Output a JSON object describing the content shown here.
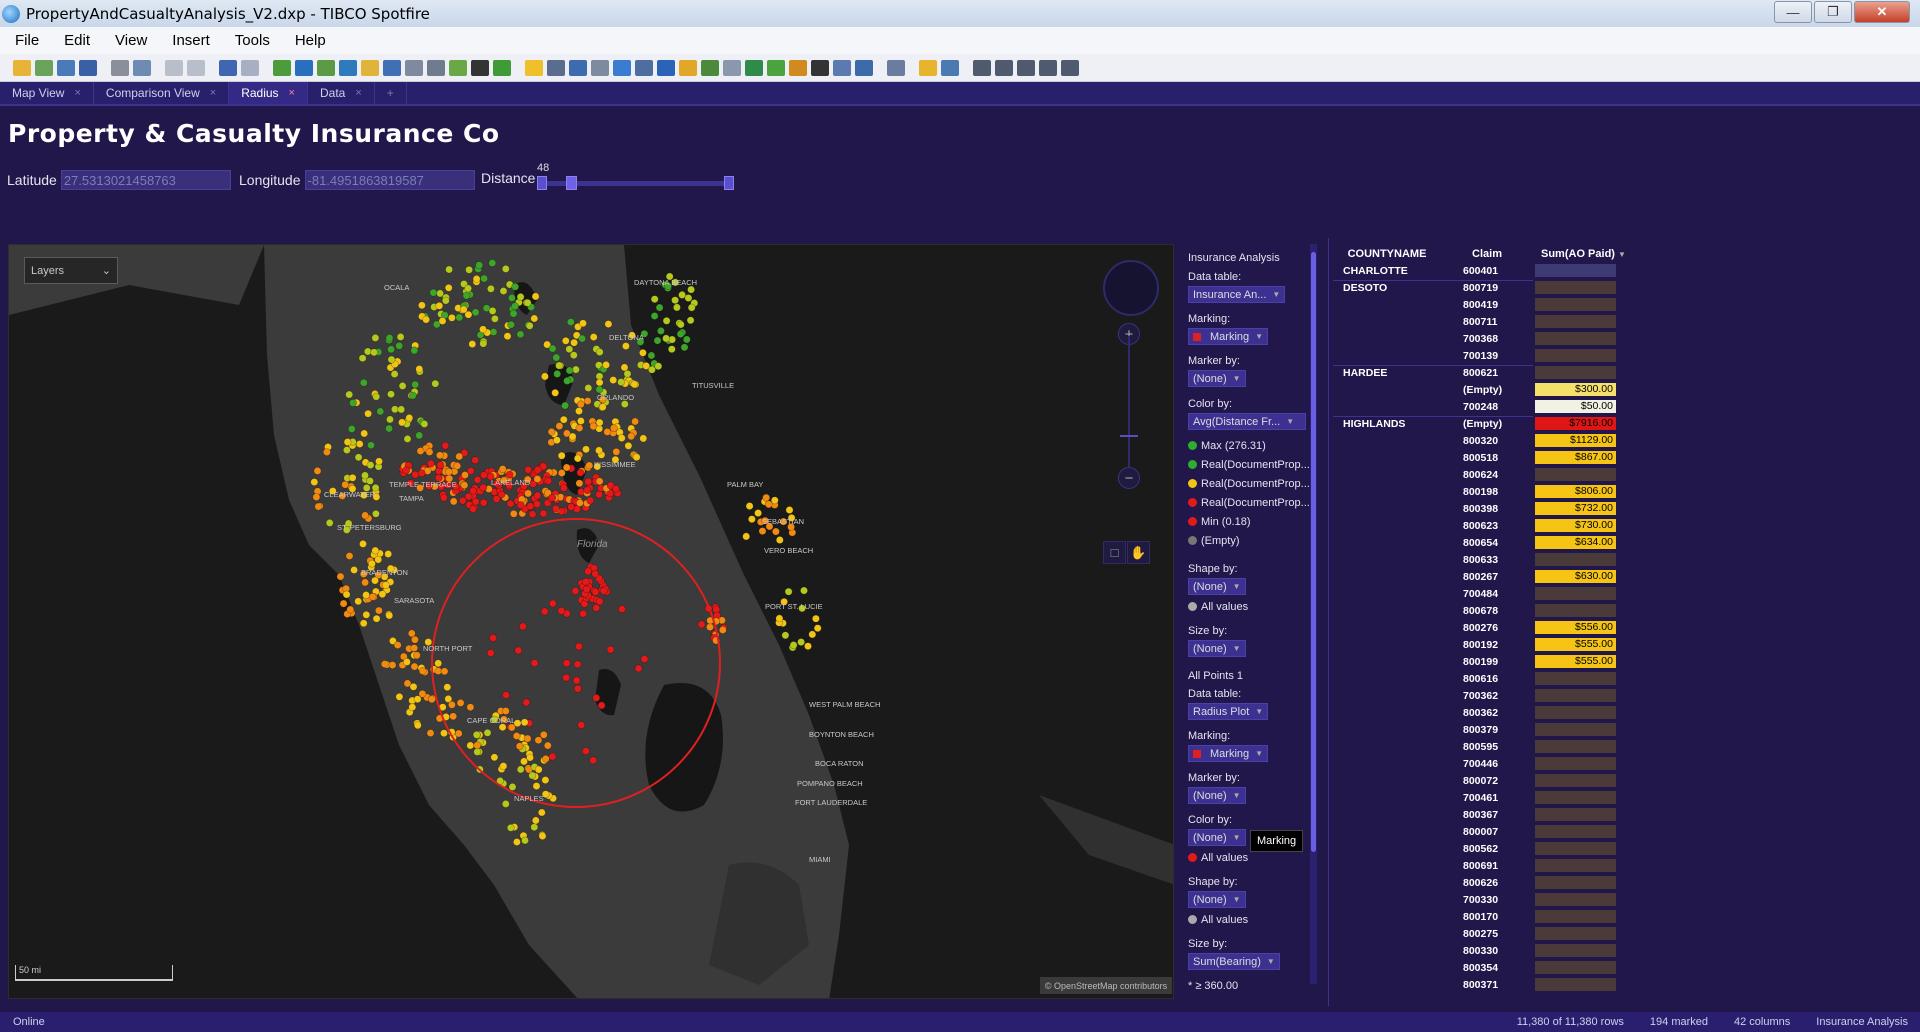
{
  "window": {
    "title": "PropertyAndCasualtyAnalysis_V2.dxp - TIBCO Spotfire"
  },
  "menu": [
    "File",
    "Edit",
    "View",
    "Insert",
    "Tools",
    "Help"
  ],
  "tabs": [
    {
      "label": "Map View",
      "active": false
    },
    {
      "label": "Comparison View",
      "active": false
    },
    {
      "label": "Radius",
      "active": true
    },
    {
      "label": "Data",
      "active": false
    }
  ],
  "page": {
    "title": "Property & Casualty Insurance Co",
    "latitude_label": "Latitude",
    "latitude_value": "27.5313021458763",
    "longitude_label": "Longitude",
    "longitude_value": "-81.4951863819587",
    "distance_label": "Distance",
    "distance_value": "48"
  },
  "map": {
    "layers_label": "Layers",
    "scale_label": "50 mi",
    "attribution": "© OpenStreetMap contributors",
    "city_labels": [
      {
        "name": "OCALA"
      },
      {
        "name": "DAYTONA BEACH"
      },
      {
        "name": "DELTONA"
      },
      {
        "name": "ORLANDO"
      },
      {
        "name": "TITUSVILLE"
      },
      {
        "name": "KISSIMMEE"
      },
      {
        "name": "PALM BAY"
      },
      {
        "name": "TEMPLE TERRACE"
      },
      {
        "name": "TAMPA"
      },
      {
        "name": "CLEARWATER"
      },
      {
        "name": "ST. PETERSBURG"
      },
      {
        "name": "LAKELAND"
      },
      {
        "name": "Florida"
      },
      {
        "name": "SEBASTIAN"
      },
      {
        "name": "VERO BEACH"
      },
      {
        "name": "BRADENTON"
      },
      {
        "name": "SARASOTA"
      },
      {
        "name": "PORT ST. LUCIE"
      },
      {
        "name": "NORTH PORT"
      },
      {
        "name": "CAPE CORAL"
      },
      {
        "name": "WEST PALM BEACH"
      },
      {
        "name": "BOYNTON BEACH"
      },
      {
        "name": "BOCA RATON"
      },
      {
        "name": "POMPANO BEACH"
      },
      {
        "name": "FORT LAUDERDALE"
      },
      {
        "name": "NAPLES"
      },
      {
        "name": "MIAMI"
      }
    ],
    "colors": {
      "green": "#3fa42a",
      "yellowgreen": "#b6c81e",
      "yellow": "#f2c416",
      "orange": "#f08a12",
      "red": "#e21a1a"
    }
  },
  "legend": {
    "layer1_title": "Insurance Analysis",
    "data_table_label": "Data table:",
    "data_table_value": "Insurance An...",
    "marking_label": "Marking:",
    "marking_value": "Marking",
    "marker_by_label": "Marker by:",
    "none": "(None)",
    "color_by_label": "Color by:",
    "color_by_value": "Avg(Distance Fr...",
    "color_items": [
      {
        "label": "Max (276.31)",
        "color": "#2eae2e"
      },
      {
        "label": "Real(DocumentProp...",
        "color": "#2eae2e"
      },
      {
        "label": "Real(DocumentProp...",
        "color": "#f2c416"
      },
      {
        "label": "Real(DocumentProp...",
        "color": "#e21a1a"
      },
      {
        "label": "Min (0.18)",
        "color": "#e21a1a"
      },
      {
        "label": "(Empty)",
        "color": "#777777"
      }
    ],
    "shape_by_label": "Shape by:",
    "all_values": "All values",
    "size_by_label": "Size by:",
    "layer2_title": "All Points 1",
    "data_table2_value": "Radius Plot",
    "size_by2_value": "Sum(Bearing)",
    "size_footer": "* ≥ 360.00",
    "tooltip": "Marking"
  },
  "table": {
    "headers": [
      "COUNTYNAME",
      "Claim",
      "Sum(AO Paid)"
    ],
    "rows": [
      {
        "county": "CHARLOTTE",
        "claim": "600401",
        "amount": "",
        "bg": "#3e3a73"
      },
      {
        "county": "DESOTO",
        "claim": "800719",
        "amount": "",
        "bg": "#4a3a3a"
      },
      {
        "county": "",
        "claim": "800419",
        "amount": "",
        "bg": "#4a3a3a"
      },
      {
        "county": "",
        "claim": "800711",
        "amount": "",
        "bg": "#4a3a3a"
      },
      {
        "county": "",
        "claim": "700368",
        "amount": "",
        "bg": "#4a3a3a"
      },
      {
        "county": "",
        "claim": "700139",
        "amount": "",
        "bg": "#4a3a3a"
      },
      {
        "county": "HARDEE",
        "claim": "800621",
        "amount": "",
        "bg": "#4a3a3a"
      },
      {
        "county": "",
        "claim": "(Empty)",
        "amount": "$300.00",
        "bg": "#f5e06a"
      },
      {
        "county": "",
        "claim": "700248",
        "amount": "$50.00",
        "bg": "#f1f1e4"
      },
      {
        "county": "HIGHLANDS",
        "claim": "(Empty)",
        "amount": "$7916.00",
        "bg": "#e01616"
      },
      {
        "county": "",
        "claim": "800320",
        "amount": "$1129.00",
        "bg": "#f5c414"
      },
      {
        "county": "",
        "claim": "800518",
        "amount": "$867.00",
        "bg": "#f5c414"
      },
      {
        "county": "",
        "claim": "800624",
        "amount": "",
        "bg": "#4a3a3a"
      },
      {
        "county": "",
        "claim": "800198",
        "amount": "$806.00",
        "bg": "#f5c414"
      },
      {
        "county": "",
        "claim": "800398",
        "amount": "$732.00",
        "bg": "#f5c414"
      },
      {
        "county": "",
        "claim": "800623",
        "amount": "$730.00",
        "bg": "#f5c414"
      },
      {
        "county": "",
        "claim": "800654",
        "amount": "$634.00",
        "bg": "#f5c414"
      },
      {
        "county": "",
        "claim": "800633",
        "amount": "",
        "bg": "#4a3a3a"
      },
      {
        "county": "",
        "claim": "800267",
        "amount": "$630.00",
        "bg": "#f5c414"
      },
      {
        "county": "",
        "claim": "700484",
        "amount": "",
        "bg": "#4a3a3a"
      },
      {
        "county": "",
        "claim": "800678",
        "amount": "",
        "bg": "#4a3a3a"
      },
      {
        "county": "",
        "claim": "800276",
        "amount": "$556.00",
        "bg": "#f5c414"
      },
      {
        "county": "",
        "claim": "800192",
        "amount": "$555.00",
        "bg": "#f5c414"
      },
      {
        "county": "",
        "claim": "800199",
        "amount": "$555.00",
        "bg": "#f5c414"
      },
      {
        "county": "",
        "claim": "800616",
        "amount": "",
        "bg": "#4a3a3a"
      },
      {
        "county": "",
        "claim": "700362",
        "amount": "",
        "bg": "#4a3a3a"
      },
      {
        "county": "",
        "claim": "800362",
        "amount": "",
        "bg": "#4a3a3a"
      },
      {
        "county": "",
        "claim": "800379",
        "amount": "",
        "bg": "#4a3a3a"
      },
      {
        "county": "",
        "claim": "800595",
        "amount": "",
        "bg": "#4a3a3a"
      },
      {
        "county": "",
        "claim": "700446",
        "amount": "",
        "bg": "#4a3a3a"
      },
      {
        "county": "",
        "claim": "800072",
        "amount": "",
        "bg": "#4a3a3a"
      },
      {
        "county": "",
        "claim": "700461",
        "amount": "",
        "bg": "#4a3a3a"
      },
      {
        "county": "",
        "claim": "800367",
        "amount": "",
        "bg": "#4a3a3a"
      },
      {
        "county": "",
        "claim": "800007",
        "amount": "",
        "bg": "#4a3a3a"
      },
      {
        "county": "",
        "claim": "800562",
        "amount": "",
        "bg": "#4a3a3a"
      },
      {
        "county": "",
        "claim": "800691",
        "amount": "",
        "bg": "#4a3a3a"
      },
      {
        "county": "",
        "claim": "800626",
        "amount": "",
        "bg": "#4a3a3a"
      },
      {
        "county": "",
        "claim": "700330",
        "amount": "",
        "bg": "#4a3a3a"
      },
      {
        "county": "",
        "claim": "800170",
        "amount": "",
        "bg": "#4a3a3a"
      },
      {
        "county": "",
        "claim": "800275",
        "amount": "",
        "bg": "#4a3a3a"
      },
      {
        "county": "",
        "claim": "800330",
        "amount": "",
        "bg": "#4a3a3a"
      },
      {
        "county": "",
        "claim": "800354",
        "amount": "",
        "bg": "#4a3a3a"
      },
      {
        "county": "",
        "claim": "800371",
        "amount": "",
        "bg": "#4a3a3a"
      }
    ]
  },
  "status": {
    "left": "Online",
    "rows": "11,380 of 11,380 rows",
    "marked": "194 marked",
    "columns": "42 columns",
    "table": "Insurance Analysis"
  }
}
